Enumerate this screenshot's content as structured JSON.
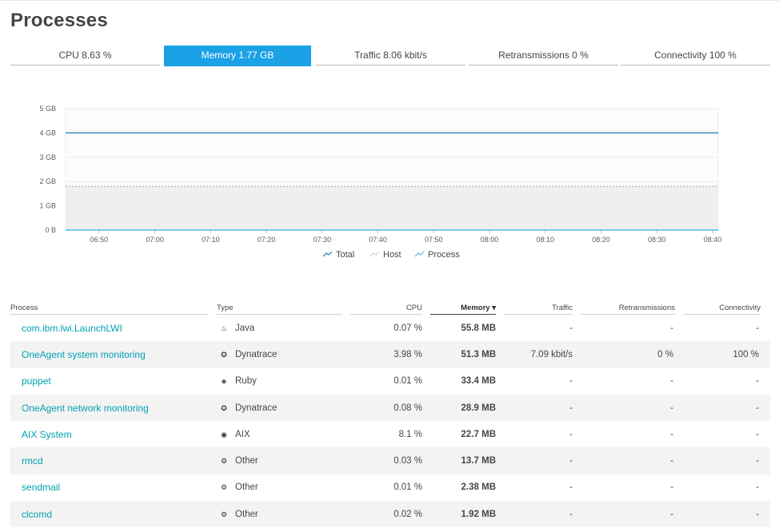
{
  "page": {
    "title": "Processes"
  },
  "tabs": [
    {
      "label": "CPU 8.63 %",
      "active": false
    },
    {
      "label": "Memory 1.77 GB",
      "active": true
    },
    {
      "label": "Traffic 8.06 kbit/s",
      "active": false
    },
    {
      "label": "Retransmissions 0 %",
      "active": false
    },
    {
      "label": "Connectivity 100 %",
      "active": false
    }
  ],
  "chart_data": {
    "type": "line",
    "y_ticks": [
      "5 GB",
      "4 GB",
      "3 GB",
      "2 GB",
      "1 GB",
      "0 B"
    ],
    "x_ticks": [
      "06:50",
      "07:00",
      "07:10",
      "07:20",
      "07:30",
      "07:40",
      "07:50",
      "08:00",
      "08:10",
      "08:20",
      "08:30",
      "08:40"
    ],
    "ylim": [
      0,
      5
    ],
    "y_unit": "GB",
    "x_range": [
      "06:44",
      "08:41"
    ],
    "grid": true,
    "legend_position": "bottom",
    "series": [
      {
        "name": "Total",
        "style": "line",
        "color": "#1f77b4",
        "x": [
          "06:44",
          "08:41"
        ],
        "values": [
          4.0,
          4.0
        ]
      },
      {
        "name": "Host",
        "style": "dotted-area",
        "color": "#a8a8a8",
        "x": [
          "06:44",
          "08:41"
        ],
        "values": [
          1.8,
          1.8
        ]
      },
      {
        "name": "Process",
        "style": "line",
        "color": "#55b8ec",
        "x": [
          "06:44",
          "08:41"
        ],
        "values": [
          0.0,
          0.0
        ]
      }
    ]
  },
  "table": {
    "headers": {
      "process": "Process",
      "type": "Type",
      "cpu": "CPU",
      "memory": "Memory ▾",
      "traffic": "Traffic",
      "retrans": "Retransmissions",
      "conn": "Connectivity"
    },
    "rows": [
      {
        "name": "com.ibm.lwi.LaunchLWI",
        "type": "Java",
        "type_icon": "java-icon",
        "glyph": "♨",
        "cpu": "0.07 %",
        "memory": "55.8 MB",
        "traffic": "-",
        "retrans": "-",
        "conn": "-"
      },
      {
        "name": "OneAgent system monitoring",
        "type": "Dynatrace",
        "type_icon": "dynatrace-icon",
        "glyph": "✪",
        "cpu": "3.98 %",
        "memory": "51.3 MB",
        "traffic": "7.09 kbit/s",
        "retrans": "0 %",
        "conn": "100 %"
      },
      {
        "name": "puppet",
        "type": "Ruby",
        "type_icon": "ruby-icon",
        "glyph": "◈",
        "cpu": "0.01 %",
        "memory": "33.4 MB",
        "traffic": "-",
        "retrans": "-",
        "conn": "-"
      },
      {
        "name": "OneAgent network monitoring",
        "type": "Dynatrace",
        "type_icon": "dynatrace-icon",
        "glyph": "✪",
        "cpu": "0.08 %",
        "memory": "28.9 MB",
        "traffic": "-",
        "retrans": "-",
        "conn": "-"
      },
      {
        "name": "AIX System",
        "type": "AIX",
        "type_icon": "aix-icon",
        "glyph": "◉",
        "cpu": "8.1 %",
        "memory": "22.7 MB",
        "traffic": "-",
        "retrans": "-",
        "conn": "-"
      },
      {
        "name": "rmcd",
        "type": "Other",
        "type_icon": "gear-icon",
        "glyph": "⚙",
        "cpu": "0.03 %",
        "memory": "13.7 MB",
        "traffic": "-",
        "retrans": "-",
        "conn": "-"
      },
      {
        "name": "sendmail",
        "type": "Other",
        "type_icon": "gear-icon",
        "glyph": "⚙",
        "cpu": "0.01 %",
        "memory": "2.38 MB",
        "traffic": "-",
        "retrans": "-",
        "conn": "-"
      },
      {
        "name": "clcomd",
        "type": "Other",
        "type_icon": "gear-icon",
        "glyph": "⚙",
        "cpu": "0.02 %",
        "memory": "1.92 MB",
        "traffic": "-",
        "retrans": "-",
        "conn": "-"
      }
    ]
  }
}
